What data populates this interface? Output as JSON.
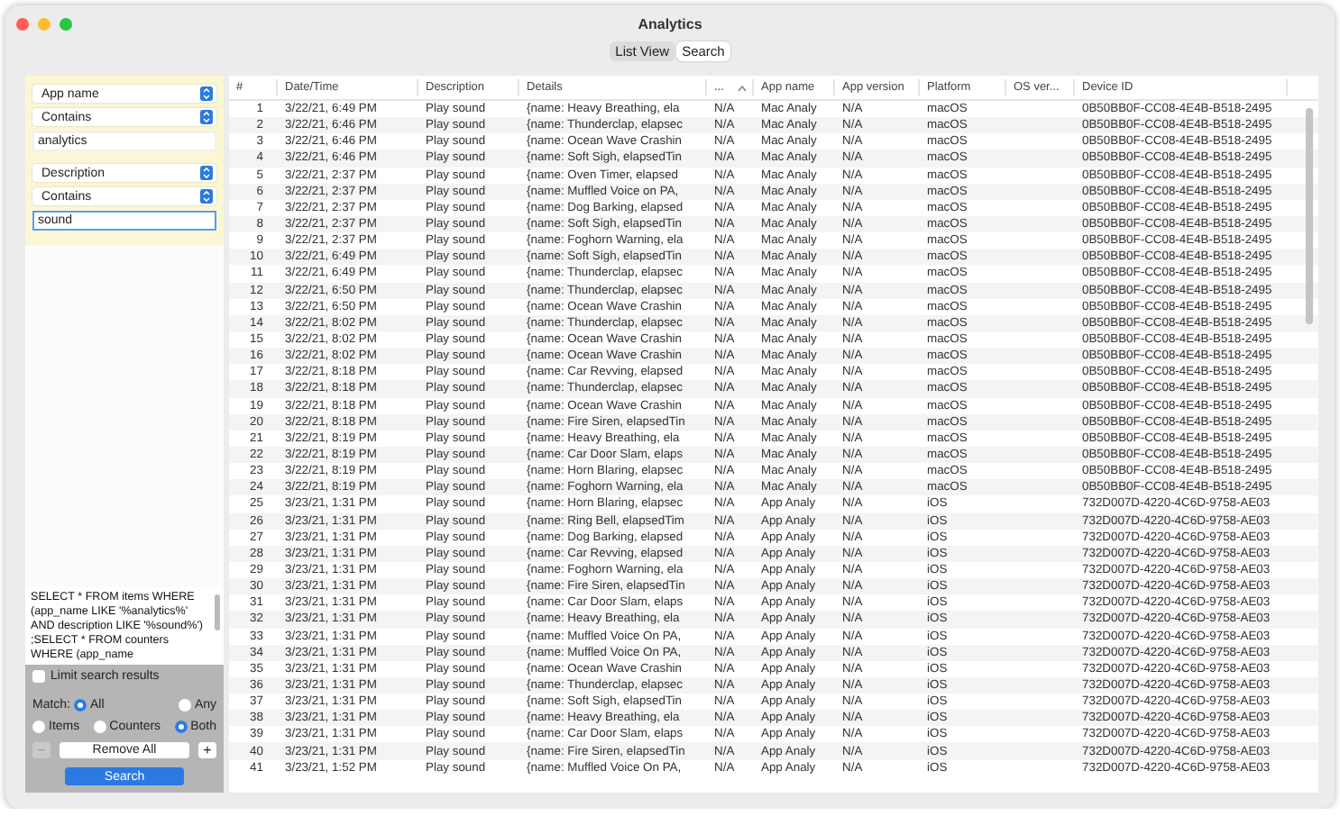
{
  "window": {
    "title": "Analytics"
  },
  "tabs": [
    {
      "label": "List View",
      "selected": false
    },
    {
      "label": "Search",
      "selected": true
    }
  ],
  "filters": [
    {
      "field": "App name",
      "operator": "Contains",
      "value": "analytics",
      "focused": false
    },
    {
      "field": "Description",
      "operator": "Contains",
      "value": "sound",
      "focused": true
    }
  ],
  "query": "SELECT * FROM items WHERE (app_name LIKE '%analytics%' AND description LIKE '%sound%') ;SELECT * FROM counters WHERE (app_name",
  "limit": {
    "label": "Limit search results",
    "checked": false
  },
  "match": {
    "label": "Match:",
    "options": [
      {
        "label": "All",
        "selected": true
      },
      {
        "label": "Any",
        "selected": false
      }
    ]
  },
  "scope": [
    {
      "label": "Items",
      "selected": false
    },
    {
      "label": "Counters",
      "selected": false
    },
    {
      "label": "Both",
      "selected": true
    }
  ],
  "buttons": {
    "minus": {
      "label": "−",
      "disabled": true
    },
    "remove": {
      "label": "Remove All"
    },
    "plus": {
      "label": "+",
      "disabled": false
    },
    "search": {
      "label": "Search"
    }
  },
  "table": {
    "columns": [
      {
        "label": "#",
        "kind": "num"
      },
      {
        "label": "Date/Time",
        "kind": "text"
      },
      {
        "label": "Description",
        "kind": "text"
      },
      {
        "label": "Details",
        "kind": "text"
      },
      {
        "label": "...",
        "kind": "sorted"
      },
      {
        "label": "App name",
        "kind": "text"
      },
      {
        "label": "App version",
        "kind": "text"
      },
      {
        "label": "Platform",
        "kind": "text"
      },
      {
        "label": "OS ver...",
        "kind": "blank"
      },
      {
        "label": "Device ID",
        "kind": "text"
      }
    ],
    "rows": [
      {
        "cells": [
          "1",
          "3/22/21, 6:49 PM",
          "Play sound",
          "{name: Heavy Breathing, ela",
          "N/A",
          "Mac Analy",
          "N/A",
          "macOS",
          "0B50BB0F-CC08-4E4B-B518-2495"
        ]
      },
      {
        "cells": [
          "2",
          "3/22/21, 6:46 PM",
          "Play sound",
          "{name: Thunderclap, elapsec",
          "N/A",
          "Mac Analy",
          "N/A",
          "macOS",
          "0B50BB0F-CC08-4E4B-B518-2495"
        ]
      },
      {
        "cells": [
          "3",
          "3/22/21, 6:46 PM",
          "Play sound",
          "{name: Ocean Wave Crashin",
          "N/A",
          "Mac Analy",
          "N/A",
          "macOS",
          "0B50BB0F-CC08-4E4B-B518-2495"
        ]
      },
      {
        "cells": [
          "4",
          "3/22/21, 6:46 PM",
          "Play sound",
          "{name: Soft Sigh, elapsedTin",
          "N/A",
          "Mac Analy",
          "N/A",
          "macOS",
          "0B50BB0F-CC08-4E4B-B518-2495"
        ]
      },
      {
        "cells": [
          "5",
          "3/22/21, 2:37 PM",
          "Play sound",
          "{name: Oven Timer, elapsed",
          "N/A",
          "Mac Analy",
          "N/A",
          "macOS",
          "0B50BB0F-CC08-4E4B-B518-2495"
        ]
      },
      {
        "cells": [
          "6",
          "3/22/21, 2:37 PM",
          "Play sound",
          "{name: Muffled Voice on PA,",
          "N/A",
          "Mac Analy",
          "N/A",
          "macOS",
          "0B50BB0F-CC08-4E4B-B518-2495"
        ]
      },
      {
        "cells": [
          "7",
          "3/22/21, 2:37 PM",
          "Play sound",
          "{name: Dog Barking, elapsed",
          "N/A",
          "Mac Analy",
          "N/A",
          "macOS",
          "0B50BB0F-CC08-4E4B-B518-2495"
        ]
      },
      {
        "cells": [
          "8",
          "3/22/21, 2:37 PM",
          "Play sound",
          "{name: Soft Sigh, elapsedTin",
          "N/A",
          "Mac Analy",
          "N/A",
          "macOS",
          "0B50BB0F-CC08-4E4B-B518-2495"
        ]
      },
      {
        "cells": [
          "9",
          "3/22/21, 2:37 PM",
          "Play sound",
          "{name: Foghorn Warning, ela",
          "N/A",
          "Mac Analy",
          "N/A",
          "macOS",
          "0B50BB0F-CC08-4E4B-B518-2495"
        ]
      },
      {
        "cells": [
          "10",
          "3/22/21, 6:49 PM",
          "Play sound",
          "{name: Soft Sigh, elapsedTin",
          "N/A",
          "Mac Analy",
          "N/A",
          "macOS",
          "0B50BB0F-CC08-4E4B-B518-2495"
        ]
      },
      {
        "cells": [
          "11",
          "3/22/21, 6:49 PM",
          "Play sound",
          "{name: Thunderclap, elapsec",
          "N/A",
          "Mac Analy",
          "N/A",
          "macOS",
          "0B50BB0F-CC08-4E4B-B518-2495"
        ]
      },
      {
        "cells": [
          "12",
          "3/22/21, 6:50 PM",
          "Play sound",
          "{name: Thunderclap, elapsec",
          "N/A",
          "Mac Analy",
          "N/A",
          "macOS",
          "0B50BB0F-CC08-4E4B-B518-2495"
        ]
      },
      {
        "cells": [
          "13",
          "3/22/21, 6:50 PM",
          "Play sound",
          "{name: Ocean Wave Crashin",
          "N/A",
          "Mac Analy",
          "N/A",
          "macOS",
          "0B50BB0F-CC08-4E4B-B518-2495"
        ]
      },
      {
        "cells": [
          "14",
          "3/22/21, 8:02 PM",
          "Play sound",
          "{name: Thunderclap, elapsec",
          "N/A",
          "Mac Analy",
          "N/A",
          "macOS",
          "0B50BB0F-CC08-4E4B-B518-2495"
        ]
      },
      {
        "cells": [
          "15",
          "3/22/21, 8:02 PM",
          "Play sound",
          "{name: Ocean Wave Crashin",
          "N/A",
          "Mac Analy",
          "N/A",
          "macOS",
          "0B50BB0F-CC08-4E4B-B518-2495"
        ]
      },
      {
        "cells": [
          "16",
          "3/22/21, 8:02 PM",
          "Play sound",
          "{name: Ocean Wave Crashin",
          "N/A",
          "Mac Analy",
          "N/A",
          "macOS",
          "0B50BB0F-CC08-4E4B-B518-2495"
        ]
      },
      {
        "cells": [
          "17",
          "3/22/21, 8:18 PM",
          "Play sound",
          "{name: Car Revving, elapsed",
          "N/A",
          "Mac Analy",
          "N/A",
          "macOS",
          "0B50BB0F-CC08-4E4B-B518-2495"
        ]
      },
      {
        "cells": [
          "18",
          "3/22/21, 8:18 PM",
          "Play sound",
          "{name: Thunderclap, elapsec",
          "N/A",
          "Mac Analy",
          "N/A",
          "macOS",
          "0B50BB0F-CC08-4E4B-B518-2495"
        ]
      },
      {
        "cells": [
          "19",
          "3/22/21, 8:18 PM",
          "Play sound",
          "{name: Ocean Wave Crashin",
          "N/A",
          "Mac Analy",
          "N/A",
          "macOS",
          "0B50BB0F-CC08-4E4B-B518-2495"
        ]
      },
      {
        "cells": [
          "20",
          "3/22/21, 8:18 PM",
          "Play sound",
          "{name: Fire Siren, elapsedTin",
          "N/A",
          "Mac Analy",
          "N/A",
          "macOS",
          "0B50BB0F-CC08-4E4B-B518-2495"
        ]
      },
      {
        "cells": [
          "21",
          "3/22/21, 8:19 PM",
          "Play sound",
          "{name: Heavy Breathing, ela",
          "N/A",
          "Mac Analy",
          "N/A",
          "macOS",
          "0B50BB0F-CC08-4E4B-B518-2495"
        ]
      },
      {
        "cells": [
          "22",
          "3/22/21, 8:19 PM",
          "Play sound",
          "{name: Car Door Slam, elaps",
          "N/A",
          "Mac Analy",
          "N/A",
          "macOS",
          "0B50BB0F-CC08-4E4B-B518-2495"
        ]
      },
      {
        "cells": [
          "23",
          "3/22/21, 8:19 PM",
          "Play sound",
          "{name: Horn Blaring, elapsec",
          "N/A",
          "Mac Analy",
          "N/A",
          "macOS",
          "0B50BB0F-CC08-4E4B-B518-2495"
        ]
      },
      {
        "cells": [
          "24",
          "3/22/21, 8:19 PM",
          "Play sound",
          "{name: Foghorn Warning, ela",
          "N/A",
          "Mac Analy",
          "N/A",
          "macOS",
          "0B50BB0F-CC08-4E4B-B518-2495"
        ]
      },
      {
        "cells": [
          "25",
          "3/23/21, 1:31 PM",
          "Play sound",
          "{name: Horn Blaring, elapsec",
          "N/A",
          "App Analy",
          "N/A",
          "iOS",
          "732D007D-4220-4C6D-9758-AE03"
        ]
      },
      {
        "cells": [
          "26",
          "3/23/21, 1:31 PM",
          "Play sound",
          "{name: Ring Bell, elapsedTim",
          "N/A",
          "App Analy",
          "N/A",
          "iOS",
          "732D007D-4220-4C6D-9758-AE03"
        ]
      },
      {
        "cells": [
          "27",
          "3/23/21, 1:31 PM",
          "Play sound",
          "{name: Dog Barking, elapsed",
          "N/A",
          "App Analy",
          "N/A",
          "iOS",
          "732D007D-4220-4C6D-9758-AE03"
        ]
      },
      {
        "cells": [
          "28",
          "3/23/21, 1:31 PM",
          "Play sound",
          "{name: Car Revving, elapsed",
          "N/A",
          "App Analy",
          "N/A",
          "iOS",
          "732D007D-4220-4C6D-9758-AE03"
        ]
      },
      {
        "cells": [
          "29",
          "3/23/21, 1:31 PM",
          "Play sound",
          "{name: Foghorn Warning, ela",
          "N/A",
          "App Analy",
          "N/A",
          "iOS",
          "732D007D-4220-4C6D-9758-AE03"
        ]
      },
      {
        "cells": [
          "30",
          "3/23/21, 1:31 PM",
          "Play sound",
          "{name: Fire Siren, elapsedTin",
          "N/A",
          "App Analy",
          "N/A",
          "iOS",
          "732D007D-4220-4C6D-9758-AE03"
        ]
      },
      {
        "cells": [
          "31",
          "3/23/21, 1:31 PM",
          "Play sound",
          "{name: Car Door Slam, elaps",
          "N/A",
          "App Analy",
          "N/A",
          "iOS",
          "732D007D-4220-4C6D-9758-AE03"
        ]
      },
      {
        "cells": [
          "32",
          "3/23/21, 1:31 PM",
          "Play sound",
          "{name: Heavy Breathing, ela",
          "N/A",
          "App Analy",
          "N/A",
          "iOS",
          "732D007D-4220-4C6D-9758-AE03"
        ]
      },
      {
        "cells": [
          "33",
          "3/23/21, 1:31 PM",
          "Play sound",
          "{name: Muffled Voice On PA,",
          "N/A",
          "App Analy",
          "N/A",
          "iOS",
          "732D007D-4220-4C6D-9758-AE03"
        ]
      },
      {
        "cells": [
          "34",
          "3/23/21, 1:31 PM",
          "Play sound",
          "{name: Muffled Voice On PA,",
          "N/A",
          "App Analy",
          "N/A",
          "iOS",
          "732D007D-4220-4C6D-9758-AE03"
        ]
      },
      {
        "cells": [
          "35",
          "3/23/21, 1:31 PM",
          "Play sound",
          "{name: Ocean Wave Crashin",
          "N/A",
          "App Analy",
          "N/A",
          "iOS",
          "732D007D-4220-4C6D-9758-AE03"
        ]
      },
      {
        "cells": [
          "36",
          "3/23/21, 1:31 PM",
          "Play sound",
          "{name: Thunderclap, elapsec",
          "N/A",
          "App Analy",
          "N/A",
          "iOS",
          "732D007D-4220-4C6D-9758-AE03"
        ]
      },
      {
        "cells": [
          "37",
          "3/23/21, 1:31 PM",
          "Play sound",
          "{name: Soft Sigh, elapsedTin",
          "N/A",
          "App Analy",
          "N/A",
          "iOS",
          "732D007D-4220-4C6D-9758-AE03"
        ]
      },
      {
        "cells": [
          "38",
          "3/23/21, 1:31 PM",
          "Play sound",
          "{name: Heavy Breathing, ela",
          "N/A",
          "App Analy",
          "N/A",
          "iOS",
          "732D007D-4220-4C6D-9758-AE03"
        ]
      },
      {
        "cells": [
          "39",
          "3/23/21, 1:31 PM",
          "Play sound",
          "{name: Car Door Slam, elaps",
          "N/A",
          "App Analy",
          "N/A",
          "iOS",
          "732D007D-4220-4C6D-9758-AE03"
        ]
      },
      {
        "cells": [
          "40",
          "3/23/21, 1:31 PM",
          "Play sound",
          "{name: Fire Siren, elapsedTin",
          "N/A",
          "App Analy",
          "N/A",
          "iOS",
          "732D007D-4220-4C6D-9758-AE03"
        ]
      },
      {
        "cells": [
          "41",
          "3/23/21, 1:52 PM",
          "Play sound",
          "{name: Muffled Voice On PA,",
          "N/A",
          "App Analy",
          "N/A",
          "iOS",
          "732D007D-4220-4C6D-9758-AE03"
        ]
      }
    ]
  }
}
